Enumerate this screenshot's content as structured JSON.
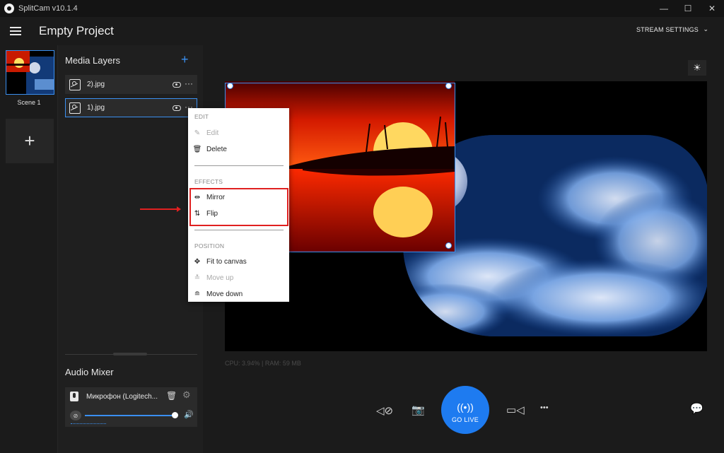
{
  "app": {
    "title": "SplitCam v10.1.4"
  },
  "window_controls": {
    "minimize": "—",
    "maximize": "☐",
    "close": "✕"
  },
  "header": {
    "project_title": "Empty Project",
    "stream_settings_label": "STREAM SETTINGS",
    "dropdown_glyph": "⌄"
  },
  "scenes": {
    "items": [
      {
        "label": "Scene 1"
      }
    ],
    "add_label": "+"
  },
  "layers": {
    "title": "Media Layers",
    "add_label": "+",
    "items": [
      {
        "name": "2).jpg",
        "selected": false
      },
      {
        "name": "1).jpg",
        "selected": true
      }
    ],
    "more_glyph": "···"
  },
  "audio_mixer": {
    "title": "Audio Mixer",
    "device_name": "Микрофон (Logitech...",
    "volume": 1.0,
    "mute_glyph": "⊘",
    "speaker_glyph": "🔊",
    "trash_glyph": "🗑",
    "settings_glyph": "⚙"
  },
  "preview": {
    "stats": "CPU: 3.94% | RAM: 59 MB",
    "brightness_glyph": "☀"
  },
  "controls": {
    "mic_glyph": "◁⊘",
    "camera_glyph": "📷",
    "go_live_label": "GO LIVE",
    "go_live_glyph": "((•))",
    "video_glyph": "▭◁",
    "more_glyph": "•••",
    "chat_glyph": "💬"
  },
  "context_menu": {
    "sections": [
      {
        "title": "EDIT",
        "items": [
          {
            "label": "Edit",
            "icon": "✎",
            "enabled": false
          },
          {
            "label": "Delete",
            "icon": "🗑",
            "enabled": true
          }
        ]
      },
      {
        "title": "EFFECTS",
        "items": [
          {
            "label": "Mirror",
            "icon": "⇹",
            "enabled": true
          },
          {
            "label": "Flip",
            "icon": "⇅",
            "enabled": true
          }
        ]
      },
      {
        "title": "POSITION",
        "items": [
          {
            "label": "Fit to canvas",
            "icon": "✥",
            "enabled": true
          },
          {
            "label": "Move up",
            "icon": "≛",
            "enabled": false
          },
          {
            "label": "Move down",
            "icon": "≘",
            "enabled": true
          }
        ]
      }
    ]
  },
  "colors": {
    "accent": "#1e7bf0",
    "annotation_red": "#e02020",
    "background": "#1b1b1b",
    "panel": "#1f1f1f"
  }
}
